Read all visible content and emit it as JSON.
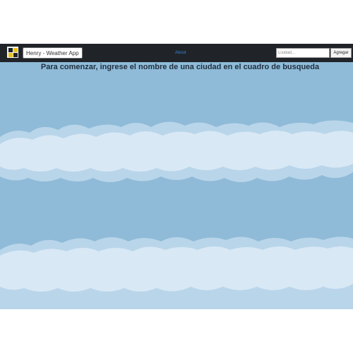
{
  "navbar": {
    "logo_icon": "grid-logo-icon",
    "brand_label": "Henry - Weather App",
    "about_label": "About",
    "search_placeholder": "Ciudad...",
    "add_label": "Agregar"
  },
  "main": {
    "message": "Para comenzar, ingrese el nombre de una ciudad en el cuadro de busqueda"
  },
  "colors": {
    "sky": "#8fbbd8",
    "cloud_back": "#bad5ea",
    "cloud_front": "#d9e9f5",
    "navbar": "#202428",
    "link": "#3a7fd1"
  }
}
